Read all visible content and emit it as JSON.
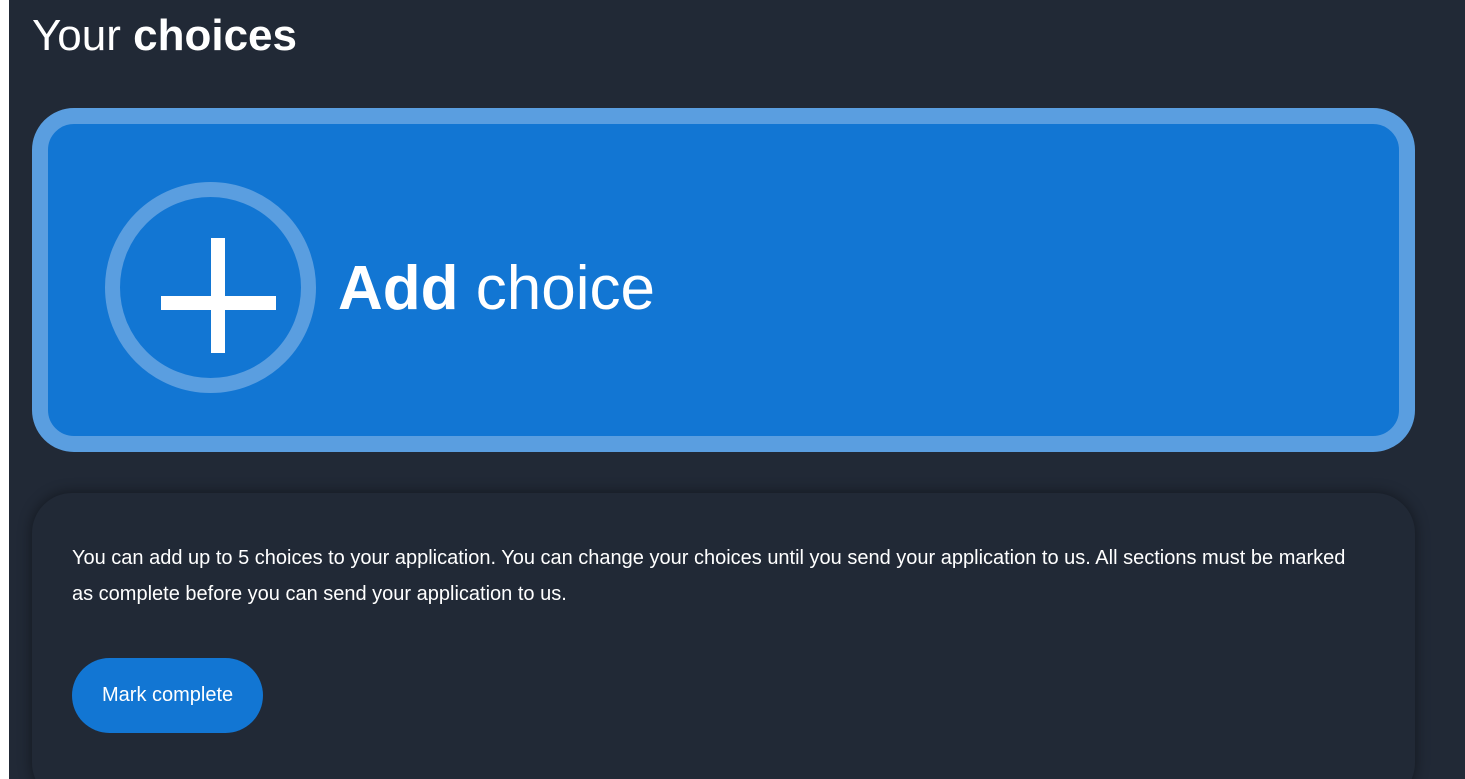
{
  "header": {
    "title_regular": "Your",
    "title_bold": "choices"
  },
  "add_choice": {
    "icon": "plus-icon",
    "label_bold": "Add",
    "label_regular": "choice"
  },
  "info": {
    "text": "You can add up to 5 choices to your application. You can change your choices until you send your application to us. All sections must be marked as complete before you can send your application to us.",
    "button_label": "Mark complete"
  },
  "colors": {
    "background": "#212936",
    "accent": "#1276d3",
    "accent_border": "#5a9ee0",
    "text": "#ffffff"
  }
}
